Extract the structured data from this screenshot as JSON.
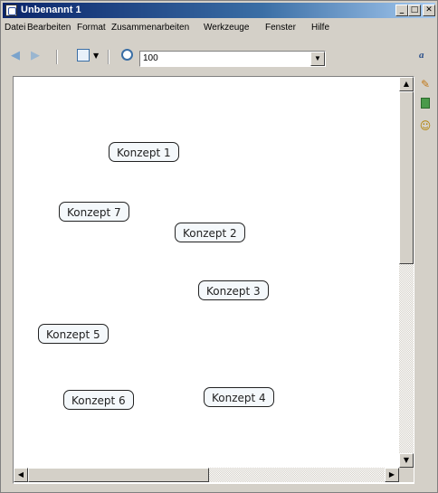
{
  "window": {
    "title": "Unbenannt 1"
  },
  "window_controls": {
    "minimize": "_",
    "maximize": "□",
    "close": "✕"
  },
  "menu": [
    "Datei",
    "Bearbeiten",
    "Format",
    "Zusammenarbeiten",
    "Werkzeuge",
    "Fenster",
    "Hilfe"
  ],
  "toolbar": {
    "zoom_value": "100"
  },
  "concepts": [
    "Konzept 1",
    "Konzept 7",
    "Konzept 2",
    "Konzept 3",
    "Konzept 5",
    "Konzept 6",
    "Konzept 4"
  ],
  "icons": [
    "app-icon",
    "back-arrow-icon",
    "forward-arrow-icon",
    "map-view-icon",
    "zoom-icon",
    "font-size-icon",
    "style-palette-icon",
    "notes-icon",
    "collaboration-icon"
  ],
  "colors": {
    "titlebar": "#0a246a",
    "chrome": "#d4d0c8",
    "concept_fill": "#f4f8fb",
    "concept_border": "#222222"
  }
}
